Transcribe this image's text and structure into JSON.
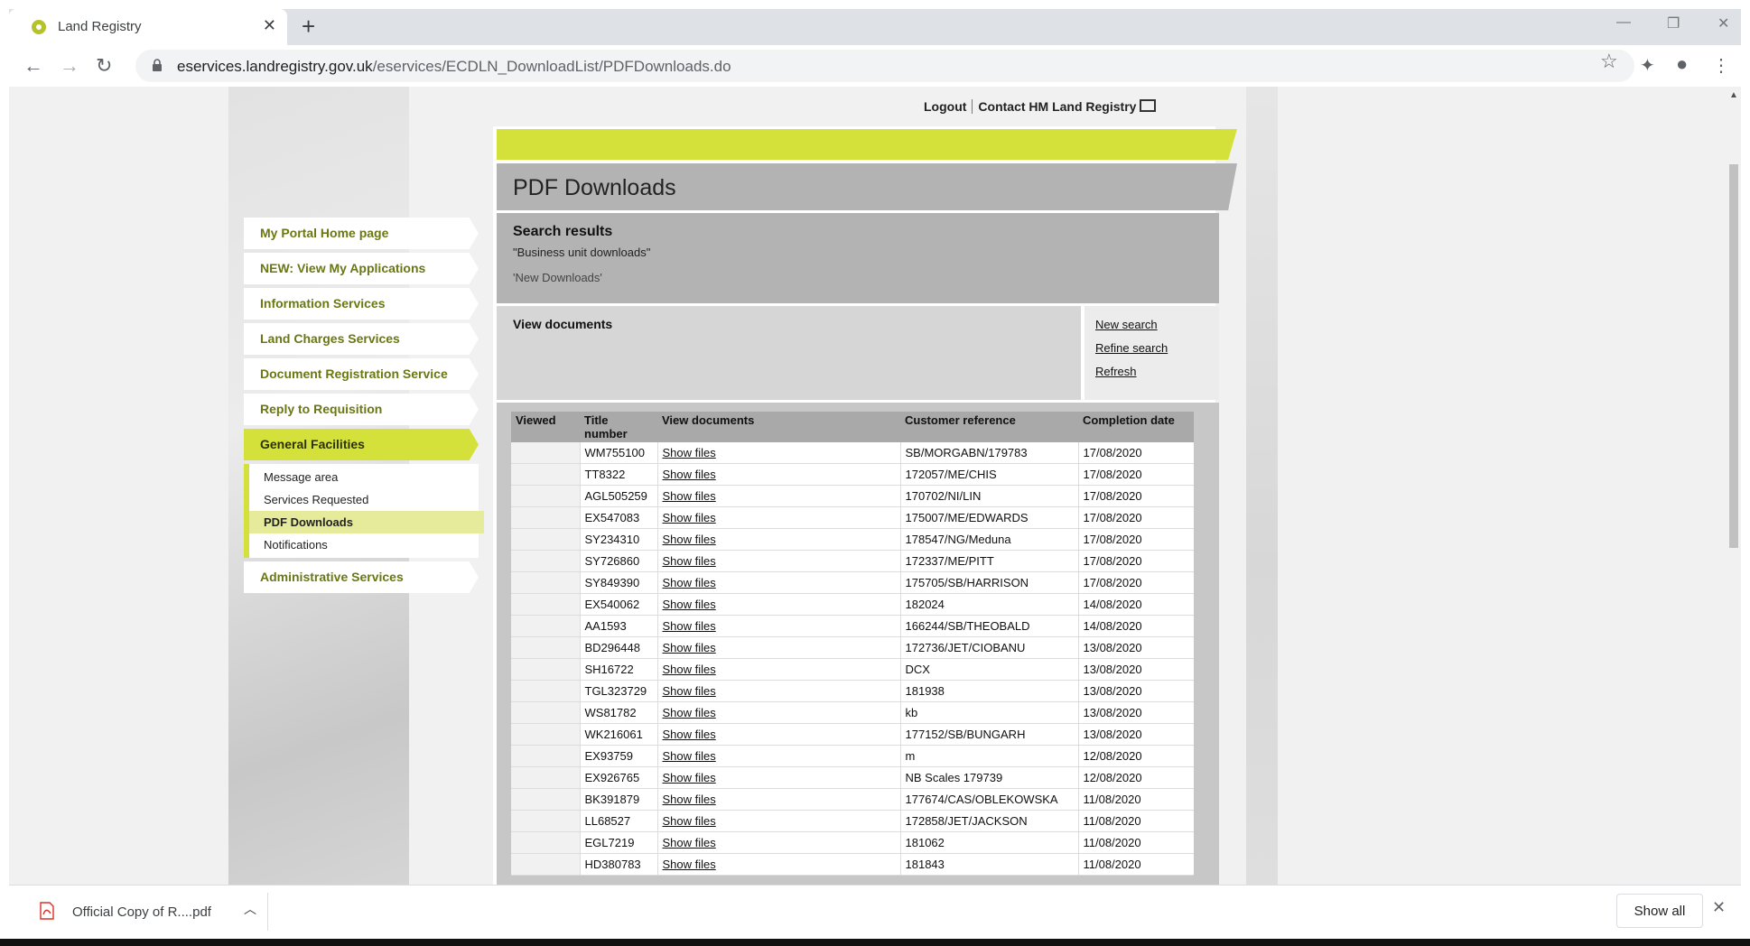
{
  "browser": {
    "tab_title": "Land Registry",
    "tab_close": "✕",
    "new_tab": "+",
    "url_host": "eservices.landregistry.gov.uk",
    "url_path": "/eservices/ECDLN_DownloadList/PDFDownloads.do",
    "minimize": "—",
    "restore": "❐",
    "close": "✕"
  },
  "header": {
    "logout": "Logout",
    "contact": "Contact HM Land Registry"
  },
  "page": {
    "title": "PDF Downloads",
    "search_results_title": "Search results",
    "search_results_line1": "\"Business unit downloads\"",
    "search_results_line2": "'New Downloads'",
    "view_documents": "View documents",
    "new_search": "New search",
    "refine_search": "Refine search",
    "refresh": "Refresh"
  },
  "nav": {
    "items": [
      {
        "label": "My Portal Home page"
      },
      {
        "label": "NEW: View My Applications"
      },
      {
        "label": "Information Services"
      },
      {
        "label": "Land Charges Services"
      },
      {
        "label": "Document Registration Service"
      },
      {
        "label": "Reply to Requisition"
      },
      {
        "label": "General Facilities"
      },
      {
        "label": "Administrative Services"
      }
    ],
    "sub_items": [
      {
        "label": "Message area"
      },
      {
        "label": "Services Requested"
      },
      {
        "label": "PDF Downloads"
      },
      {
        "label": "Notifications"
      }
    ]
  },
  "table": {
    "headers": [
      "Viewed",
      "Title number",
      "View documents",
      "Customer reference",
      "Completion date"
    ],
    "show_files_label": "Show files",
    "rows": [
      {
        "viewed": "",
        "title": "WM755100",
        "ref": "SB/MORGABN/179783",
        "date": "17/08/2020"
      },
      {
        "viewed": "",
        "title": "TT8322",
        "ref": "172057/ME/CHIS",
        "date": "17/08/2020"
      },
      {
        "viewed": "",
        "title": "AGL505259",
        "ref": "170702/NI/LIN",
        "date": "17/08/2020"
      },
      {
        "viewed": "",
        "title": "EX547083",
        "ref": "175007/ME/EDWARDS",
        "date": "17/08/2020"
      },
      {
        "viewed": "",
        "title": "SY234310",
        "ref": "178547/NG/Meduna",
        "date": "17/08/2020"
      },
      {
        "viewed": "",
        "title": "SY726860",
        "ref": "172337/ME/PITT",
        "date": "17/08/2020"
      },
      {
        "viewed": "",
        "title": "SY849390",
        "ref": "175705/SB/HARRISON",
        "date": "17/08/2020"
      },
      {
        "viewed": "",
        "title": "EX540062",
        "ref": "182024",
        "date": "14/08/2020"
      },
      {
        "viewed": "",
        "title": "AA1593",
        "ref": "166244/SB/THEOBALD",
        "date": "14/08/2020"
      },
      {
        "viewed": "",
        "title": "BD296448",
        "ref": "172736/JET/CIOBANU",
        "date": "13/08/2020"
      },
      {
        "viewed": "",
        "title": "SH16722",
        "ref": "DCX",
        "date": "13/08/2020"
      },
      {
        "viewed": "",
        "title": "TGL323729",
        "ref": "181938",
        "date": "13/08/2020"
      },
      {
        "viewed": "",
        "title": "WS81782",
        "ref": "kb",
        "date": "13/08/2020"
      },
      {
        "viewed": "",
        "title": "WK216061",
        "ref": "177152/SB/BUNGARH",
        "date": "13/08/2020"
      },
      {
        "viewed": "",
        "title": "EX93759",
        "ref": "m",
        "date": "12/08/2020"
      },
      {
        "viewed": "",
        "title": "EX926765",
        "ref": "NB Scales 179739",
        "date": "12/08/2020"
      },
      {
        "viewed": "",
        "title": "BK391879",
        "ref": "177674/CAS/OBLEKOWSKA",
        "date": "11/08/2020"
      },
      {
        "viewed": "",
        "title": "LL68527",
        "ref": "172858/JET/JACKSON",
        "date": "11/08/2020"
      },
      {
        "viewed": "",
        "title": "EGL7219",
        "ref": "181062",
        "date": "11/08/2020"
      },
      {
        "viewed": "",
        "title": "HD380783",
        "ref": "181843",
        "date": "11/08/2020"
      }
    ]
  },
  "downloads": {
    "file_name": "Official Copy of R....pdf",
    "show_all": "Show all"
  },
  "colors": {
    "accent": "#d4e13a",
    "nav_text": "#6a7712",
    "panel_grey": "#b3b3b3"
  }
}
